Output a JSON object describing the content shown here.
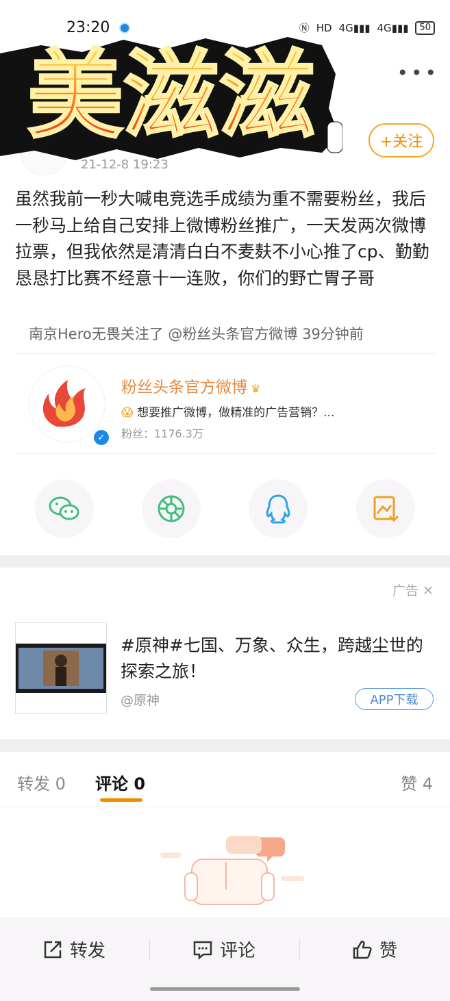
{
  "status": {
    "time": "23:20",
    "network": "4G",
    "battery": "50"
  },
  "sticker": {
    "text": "美滋滋"
  },
  "post": {
    "date": "21-12-8 19:23",
    "follow_label": "+关注",
    "text": "虽然我前一秒大喊电竞选手成绩为重不需要粉丝，我后一秒马上给自己安排上微博粉丝推广，一天发两次微博拉票，但我依然是清清白白不麦麸不小心推了cp、勤勤恳恳打比赛不经意十一连败，你们的野亡胃子哥",
    "repost_note": "南京Hero无畏关注了 @粉丝头条官方微博 39分钟前"
  },
  "account_card": {
    "name": "粉丝头条官方微博",
    "desc": "想要推广微博，做精准的广告营销？...",
    "fans": "粉丝：1176.3万"
  },
  "share": [
    "wechat-icon",
    "moments-icon",
    "qq-icon",
    "save-image-icon"
  ],
  "ad": {
    "label": "广告",
    "title": "#原神#七国、万象、众生，跨越尘世的探索之旅！",
    "account": "@原神",
    "button": "APP下载"
  },
  "tabs": {
    "repost": "转发 0",
    "comment": "评论 0",
    "like": "赞 4"
  },
  "actions": {
    "repost": "转发",
    "comment": "评论",
    "like": "赞"
  },
  "colors": {
    "accent": "#f08c00",
    "link": "#4a8bd0",
    "verify": "#1e88e5"
  }
}
